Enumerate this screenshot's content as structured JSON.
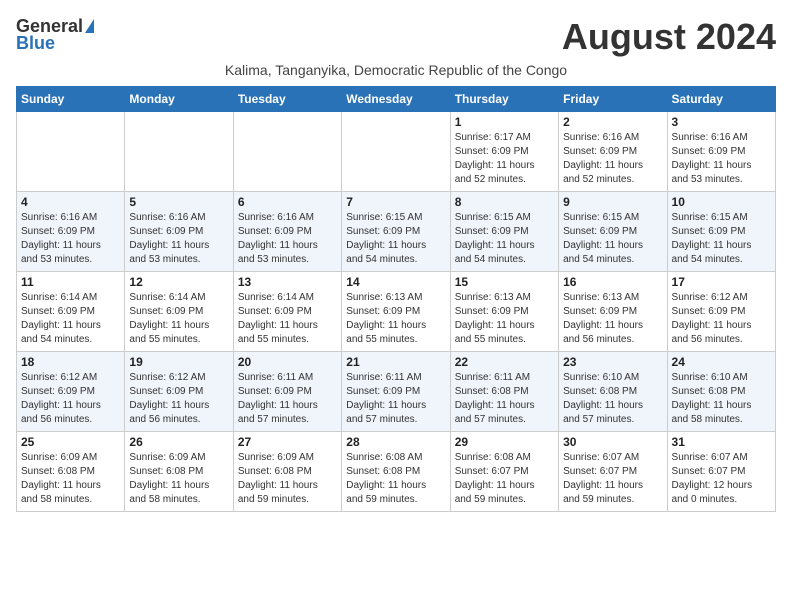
{
  "header": {
    "logo_general": "General",
    "logo_blue": "Blue",
    "month_title": "August 2024",
    "subtitle": "Kalima, Tanganyika, Democratic Republic of the Congo"
  },
  "days_of_week": [
    "Sunday",
    "Monday",
    "Tuesday",
    "Wednesday",
    "Thursday",
    "Friday",
    "Saturday"
  ],
  "weeks": [
    [
      {
        "day": "",
        "info": ""
      },
      {
        "day": "",
        "info": ""
      },
      {
        "day": "",
        "info": ""
      },
      {
        "day": "",
        "info": ""
      },
      {
        "day": "1",
        "info": "Sunrise: 6:17 AM\nSunset: 6:09 PM\nDaylight: 11 hours\nand 52 minutes."
      },
      {
        "day": "2",
        "info": "Sunrise: 6:16 AM\nSunset: 6:09 PM\nDaylight: 11 hours\nand 52 minutes."
      },
      {
        "day": "3",
        "info": "Sunrise: 6:16 AM\nSunset: 6:09 PM\nDaylight: 11 hours\nand 53 minutes."
      }
    ],
    [
      {
        "day": "4",
        "info": "Sunrise: 6:16 AM\nSunset: 6:09 PM\nDaylight: 11 hours\nand 53 minutes."
      },
      {
        "day": "5",
        "info": "Sunrise: 6:16 AM\nSunset: 6:09 PM\nDaylight: 11 hours\nand 53 minutes."
      },
      {
        "day": "6",
        "info": "Sunrise: 6:16 AM\nSunset: 6:09 PM\nDaylight: 11 hours\nand 53 minutes."
      },
      {
        "day": "7",
        "info": "Sunrise: 6:15 AM\nSunset: 6:09 PM\nDaylight: 11 hours\nand 54 minutes."
      },
      {
        "day": "8",
        "info": "Sunrise: 6:15 AM\nSunset: 6:09 PM\nDaylight: 11 hours\nand 54 minutes."
      },
      {
        "day": "9",
        "info": "Sunrise: 6:15 AM\nSunset: 6:09 PM\nDaylight: 11 hours\nand 54 minutes."
      },
      {
        "day": "10",
        "info": "Sunrise: 6:15 AM\nSunset: 6:09 PM\nDaylight: 11 hours\nand 54 minutes."
      }
    ],
    [
      {
        "day": "11",
        "info": "Sunrise: 6:14 AM\nSunset: 6:09 PM\nDaylight: 11 hours\nand 54 minutes."
      },
      {
        "day": "12",
        "info": "Sunrise: 6:14 AM\nSunset: 6:09 PM\nDaylight: 11 hours\nand 55 minutes."
      },
      {
        "day": "13",
        "info": "Sunrise: 6:14 AM\nSunset: 6:09 PM\nDaylight: 11 hours\nand 55 minutes."
      },
      {
        "day": "14",
        "info": "Sunrise: 6:13 AM\nSunset: 6:09 PM\nDaylight: 11 hours\nand 55 minutes."
      },
      {
        "day": "15",
        "info": "Sunrise: 6:13 AM\nSunset: 6:09 PM\nDaylight: 11 hours\nand 55 minutes."
      },
      {
        "day": "16",
        "info": "Sunrise: 6:13 AM\nSunset: 6:09 PM\nDaylight: 11 hours\nand 56 minutes."
      },
      {
        "day": "17",
        "info": "Sunrise: 6:12 AM\nSunset: 6:09 PM\nDaylight: 11 hours\nand 56 minutes."
      }
    ],
    [
      {
        "day": "18",
        "info": "Sunrise: 6:12 AM\nSunset: 6:09 PM\nDaylight: 11 hours\nand 56 minutes."
      },
      {
        "day": "19",
        "info": "Sunrise: 6:12 AM\nSunset: 6:09 PM\nDaylight: 11 hours\nand 56 minutes."
      },
      {
        "day": "20",
        "info": "Sunrise: 6:11 AM\nSunset: 6:09 PM\nDaylight: 11 hours\nand 57 minutes."
      },
      {
        "day": "21",
        "info": "Sunrise: 6:11 AM\nSunset: 6:09 PM\nDaylight: 11 hours\nand 57 minutes."
      },
      {
        "day": "22",
        "info": "Sunrise: 6:11 AM\nSunset: 6:08 PM\nDaylight: 11 hours\nand 57 minutes."
      },
      {
        "day": "23",
        "info": "Sunrise: 6:10 AM\nSunset: 6:08 PM\nDaylight: 11 hours\nand 57 minutes."
      },
      {
        "day": "24",
        "info": "Sunrise: 6:10 AM\nSunset: 6:08 PM\nDaylight: 11 hours\nand 58 minutes."
      }
    ],
    [
      {
        "day": "25",
        "info": "Sunrise: 6:09 AM\nSunset: 6:08 PM\nDaylight: 11 hours\nand 58 minutes."
      },
      {
        "day": "26",
        "info": "Sunrise: 6:09 AM\nSunset: 6:08 PM\nDaylight: 11 hours\nand 58 minutes."
      },
      {
        "day": "27",
        "info": "Sunrise: 6:09 AM\nSunset: 6:08 PM\nDaylight: 11 hours\nand 59 minutes."
      },
      {
        "day": "28",
        "info": "Sunrise: 6:08 AM\nSunset: 6:08 PM\nDaylight: 11 hours\nand 59 minutes."
      },
      {
        "day": "29",
        "info": "Sunrise: 6:08 AM\nSunset: 6:07 PM\nDaylight: 11 hours\nand 59 minutes."
      },
      {
        "day": "30",
        "info": "Sunrise: 6:07 AM\nSunset: 6:07 PM\nDaylight: 11 hours\nand 59 minutes."
      },
      {
        "day": "31",
        "info": "Sunrise: 6:07 AM\nSunset: 6:07 PM\nDaylight: 12 hours\nand 0 minutes."
      }
    ]
  ]
}
